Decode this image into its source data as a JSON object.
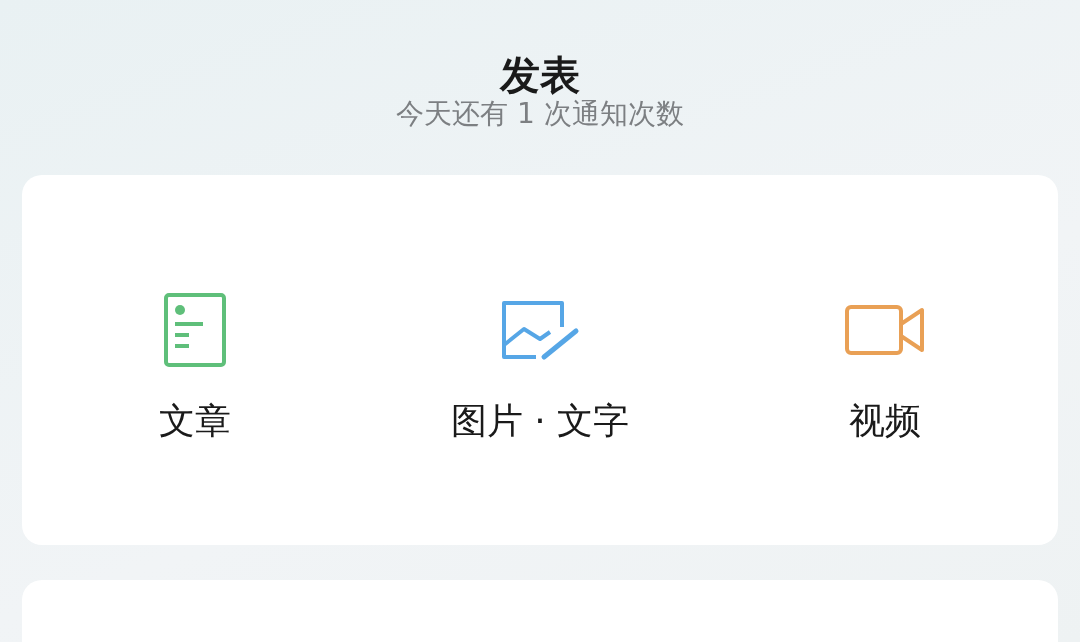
{
  "header": {
    "title": "发表",
    "subtitle": "今天还有 1 次通知次数"
  },
  "options": [
    {
      "kind": "article",
      "label": "文章"
    },
    {
      "kind": "image",
      "label": "图片 · 文字"
    },
    {
      "kind": "video",
      "label": "视频"
    }
  ]
}
